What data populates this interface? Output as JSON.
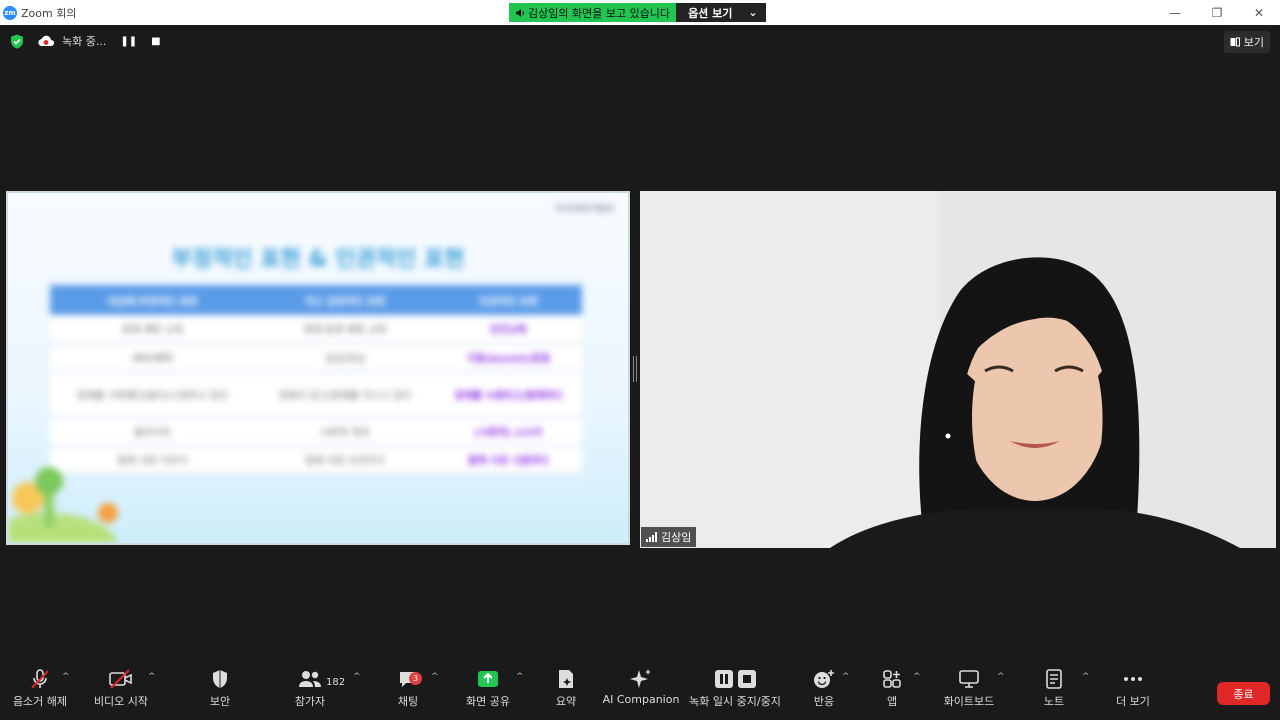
{
  "window": {
    "app_title": "Zoom 회의",
    "logo_text": "zm",
    "share_banner": "김상임의 화면을 보고 있습니다",
    "view_options": "옵션 보기"
  },
  "topbar": {
    "recording_status": "녹화 중...",
    "view_button": "보기"
  },
  "slide": {
    "logo_text": "한국장애인개발원",
    "title": "부정적인 표현 & 인권적인 표현",
    "headers": [
      "대상화/부정적인 표현",
      "적고 공정적인 표현",
      "인권적인 표현"
    ],
    "rows": [
      [
        "장애 예방 교육",
        "장애 발생 예방 교육",
        "안전교육"
      ],
      [
        "배려/혜택",
        "공감/관심",
        "지원(Assist)/존중"
      ],
      [
        "장애를 극복했다/앓다/고생하고 있다",
        "장애가 있고/장애를 지니고 있다",
        "장애를 수용하고/함께하다"
      ],
      [
        "불우이웃",
        "사회적 약자",
        "(사회적) 소수자"
      ],
      [
        "힘께 서로 이끈다",
        "힘께 서로 도와주다",
        "함께 서로 사용하다"
      ]
    ]
  },
  "participant": {
    "name": "김상임"
  },
  "toolbar": {
    "mute": "음소거 해제",
    "video": "비디오 시작",
    "security": "보안",
    "participants": "참가자",
    "participants_count": "182",
    "chat": "채팅",
    "chat_badge": "3",
    "share": "화면 공유",
    "summary": "요약",
    "ai": "AI Companion",
    "recording": "녹화 일시 중지/중지",
    "reactions": "반응",
    "apps": "앱",
    "whiteboard": "화이트보드",
    "notes": "노트",
    "more": "더 보기",
    "end": "종료"
  },
  "colors": {
    "share_green": "#23c552",
    "end_red": "#e02828",
    "slide_title_blue": "#3aa0d8",
    "table_header_blue": "#5a9be8",
    "positive_purple": "#8a2be2"
  },
  "icons": [
    "shield-icon",
    "cloud-record-icon",
    "pause-icon",
    "stop-icon",
    "mic-off-icon",
    "camera-off-icon",
    "people-icon",
    "chat-icon",
    "share-up-arrow-icon",
    "summary-icon",
    "sparkle-icon",
    "reaction-icon",
    "apps-icon",
    "whiteboard-icon",
    "notes-icon",
    "ellipsis-icon",
    "signal-icon"
  ]
}
